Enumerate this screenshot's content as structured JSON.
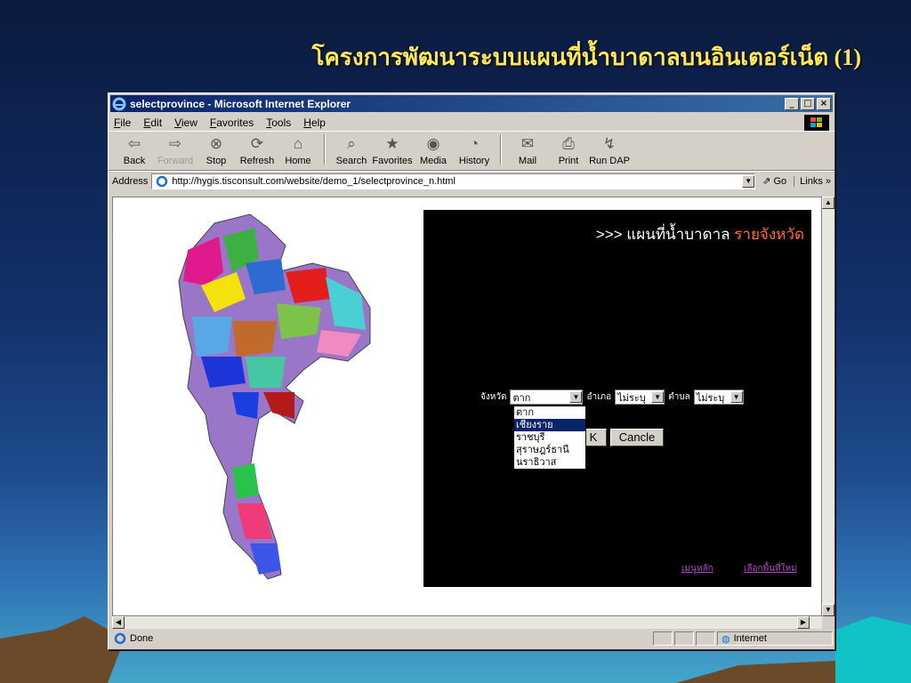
{
  "slide": {
    "title": "โครงการพัฒนาระบบแผนที่น้ำบาดาลบนอินเตอร์เน็ต (1)"
  },
  "window": {
    "title": "selectprovince - Microsoft Internet Explorer",
    "controls": {
      "minimize": "_",
      "maximize": "□",
      "close": "×"
    }
  },
  "menu": [
    "File",
    "Edit",
    "View",
    "Favorites",
    "Tools",
    "Help"
  ],
  "toolbar": {
    "buttons": [
      {
        "label": "Back",
        "icon": "back-arrow-icon"
      },
      {
        "label": "Forward",
        "icon": "forward-arrow-icon"
      },
      {
        "label": "Stop",
        "icon": "stop-icon"
      },
      {
        "label": "Refresh",
        "icon": "refresh-icon"
      },
      {
        "label": "Home",
        "icon": "home-icon"
      },
      {
        "label": "Search",
        "icon": "search-icon"
      },
      {
        "label": "Favorites",
        "icon": "favorites-icon"
      },
      {
        "label": "Media",
        "icon": "media-icon"
      },
      {
        "label": "History",
        "icon": "history-icon"
      },
      {
        "label": "Mail",
        "icon": "mail-icon"
      },
      {
        "label": "Print",
        "icon": "print-icon"
      },
      {
        "label": "Run DAP",
        "icon": "run-dap-icon"
      }
    ]
  },
  "address": {
    "label": "Address",
    "url": "http://hygis.tisconsult.com/website/demo_1/selectprovince_n.html",
    "go": "Go",
    "links": "Links »"
  },
  "page": {
    "heading_prefix": ">>> แผนที่น้ำบาดาล",
    "heading_accent": "รายจังหวัด",
    "province_label": "จังหวัด",
    "province_value": "ตาก",
    "district_label": "อำเภอ",
    "district_value": "ไม่ระบุ",
    "subdistrict_label": "ตำบล",
    "subdistrict_value": "ไม่ระบุ",
    "dropdown_options": [
      "ตาก",
      "เชียงราย",
      "ราชบุรี",
      "สุราษฎร์ธานี",
      "นราธิวาส"
    ],
    "ok_button": "K",
    "cancel_button": "Cancle",
    "link_main": "เมนูหลัก",
    "link_new_area": "เลือกพื้นที่ใหม่"
  },
  "status": {
    "text": "Done",
    "zone": "Internet"
  },
  "colors": {
    "accent": "#ff6a3d",
    "title": "#ffe65a",
    "link": "#b04cc4",
    "selected": "#0a246a"
  }
}
